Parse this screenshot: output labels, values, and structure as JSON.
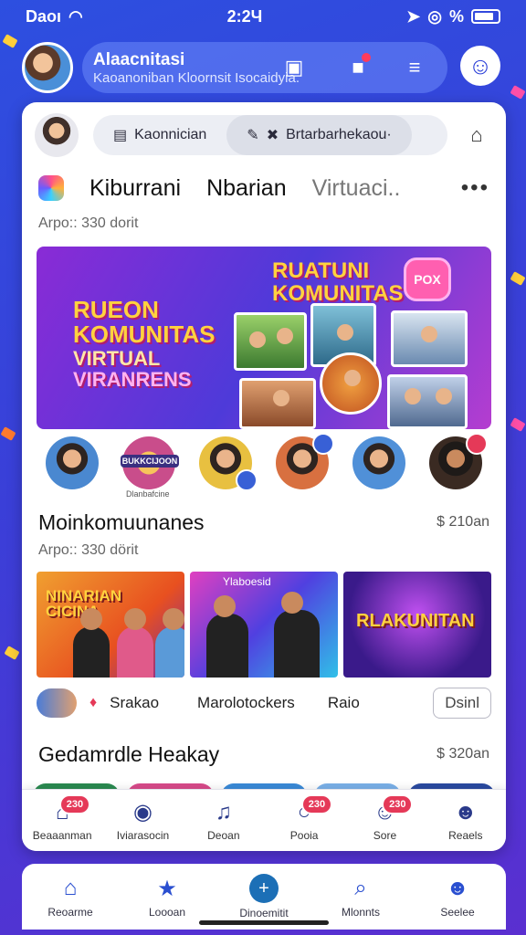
{
  "status_bar": {
    "carrier": "Daoı",
    "time": "2:2Ч",
    "battery_pct": "%"
  },
  "header": {
    "title": "Alaacnitasi",
    "subtitle": "Kaoanoniban Kloornsit Isocaidyia.",
    "icons": [
      "camera-icon",
      "chat-icon",
      "filter-icon",
      "profile-icon"
    ]
  },
  "card_top": {
    "segment_1": "Kaonnician",
    "segment_2": "Brtarbarhekaou·"
  },
  "tabs": [
    "Kiburrani",
    "Nbarian",
    "Virtuaci.."
  ],
  "meta_1": "Arpo:: 330 dorit",
  "banner": {
    "left_lines": [
      "RUEON",
      "KOMUNITAS",
      "VIRTUAL",
      "VIRANRENS"
    ],
    "right_title": [
      "RUATUNI",
      "KOMUNITAS"
    ],
    "heart_text": "POX"
  },
  "avatar_row": {
    "label": "BUKKCIJOON",
    "sublabel": "Dlanbafcine"
  },
  "section_1": {
    "title": "Moinkomuunanes",
    "price": "$ 210an"
  },
  "meta_2": "Arpo:: 330 dörit",
  "thumbs": [
    {
      "title": "NINARIAN CICINA",
      "label": ""
    },
    {
      "title": "",
      "label": "Ylaboesid"
    },
    {
      "title": "RLAKUNITAN",
      "label": ""
    }
  ],
  "cards_footer": {
    "label_1": "Srakao",
    "label_2": "Marolotockers",
    "label_3": "Raio",
    "button": "Dsinl"
  },
  "section_2": {
    "title": "Gedamrdle Heakay",
    "price": "$ 320an"
  },
  "inner_nav": [
    {
      "label": "Beaaanman",
      "icon": "home-icon",
      "badge": "230"
    },
    {
      "label": "Iviarasocin",
      "icon": "location-icon",
      "badge": ""
    },
    {
      "label": "Deoan",
      "icon": "music-icon",
      "badge": ""
    },
    {
      "label": "Pooia",
      "icon": "chat-bubble-icon",
      "badge": "230"
    },
    {
      "label": "Sore",
      "icon": "emoji-icon",
      "badge": "230"
    },
    {
      "label": "Reaels",
      "icon": "person-icon",
      "badge": ""
    }
  ],
  "bottom_nav": [
    {
      "label": "Reoarme",
      "icon": "home-icon"
    },
    {
      "label": "Loooan",
      "icon": "star-icon"
    },
    {
      "label": "Dinoemitit",
      "icon": "plus-icon"
    },
    {
      "label": "Mlonnts",
      "icon": "search-icon"
    },
    {
      "label": "Seelee",
      "icon": "person-icon"
    }
  ],
  "colors": {
    "brand": "#2d4fe0",
    "badge": "#e53958",
    "banner_text": "#ffd23f"
  }
}
